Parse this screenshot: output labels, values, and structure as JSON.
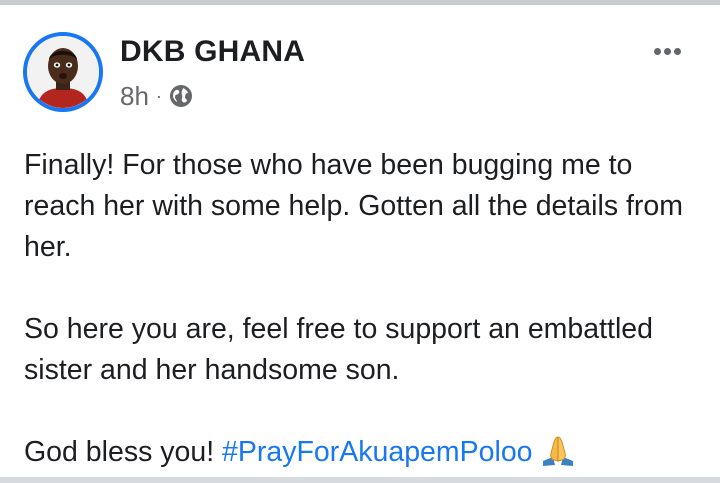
{
  "post": {
    "author": "DKB GHANA",
    "time": "8h",
    "separator": "·",
    "audience_icon": "globe-icon",
    "more_icon": "more-options-icon",
    "paragraphs": [
      "Finally! For those who have been bugging me to reach her with some help. Gotten all the details from her.",
      "So here you are, feel free to support an embattled sister and her handsome son."
    ],
    "closing_text": "God bless you!",
    "hashtag": "#PrayForAkuapemPoloo",
    "emoji": "praying-hands-icon"
  },
  "colors": {
    "link": "#1877f2",
    "text": "#1c1e21",
    "meta": "#65676b",
    "avatar_ring": "#1877f2"
  }
}
